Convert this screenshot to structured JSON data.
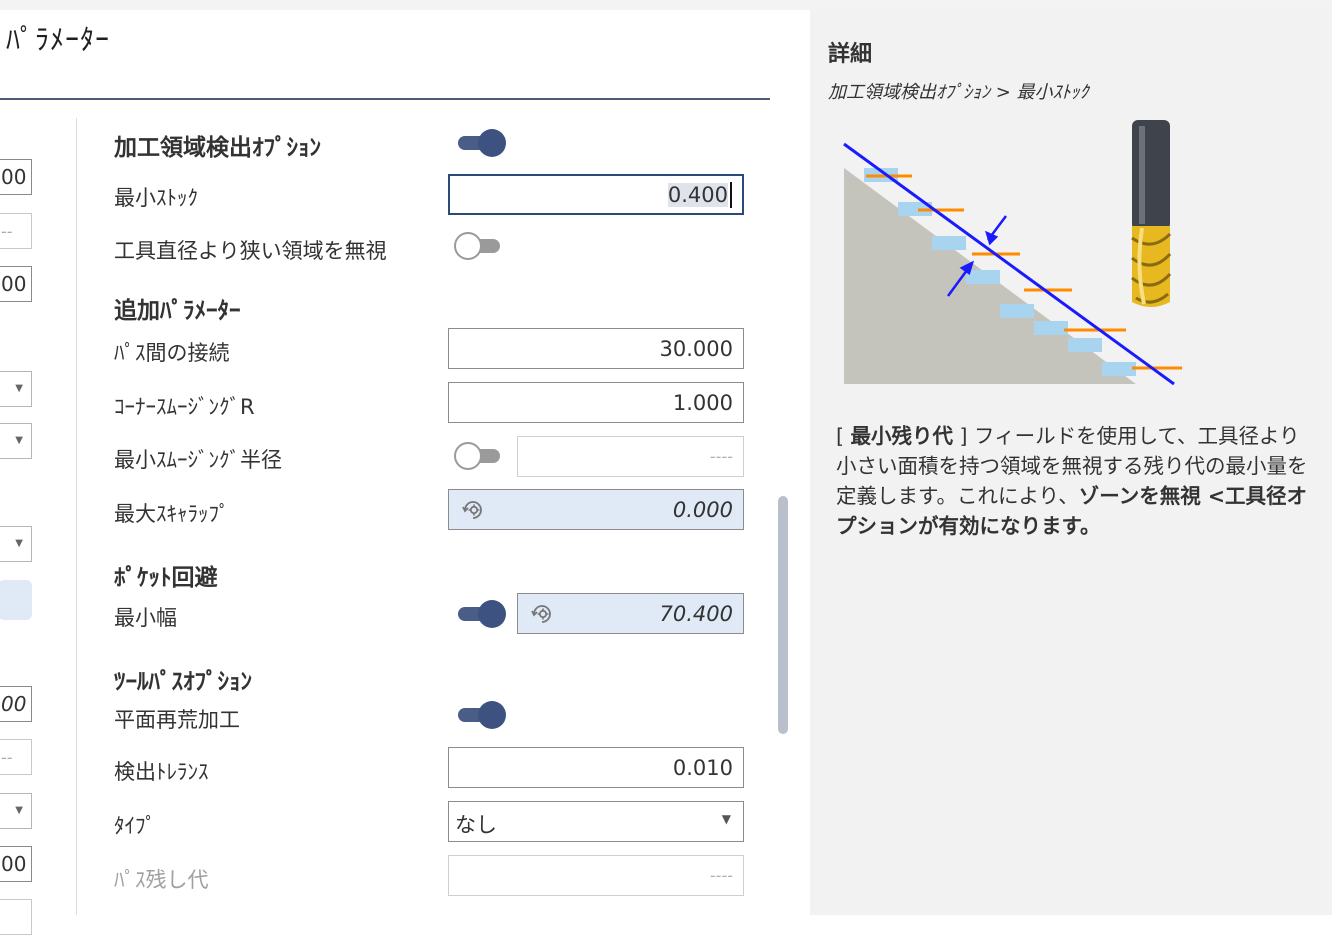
{
  "header": {
    "title": "ﾊﾟﾗﾒｰﾀｰ"
  },
  "left_column": {
    "items": [
      {
        "text": "00",
        "style": "input"
      },
      {
        "text": "--",
        "style": "dash"
      },
      {
        "text": "00",
        "style": "input"
      },
      {
        "text": "",
        "style": "select"
      },
      {
        "text": "",
        "style": "select"
      },
      {
        "text": "",
        "style": "select"
      },
      {
        "text": "",
        "style": "highlight"
      },
      {
        "text": "00",
        "style": "italic"
      },
      {
        "text": "--",
        "style": "dash"
      },
      {
        "text": "",
        "style": "select"
      },
      {
        "text": "00",
        "style": "input"
      },
      {
        "text": "",
        "style": "dash"
      }
    ]
  },
  "sections": {
    "detection": {
      "title": "加工領域検出ｵﾌﾟｼｮﾝ",
      "enabled": true,
      "min_stock_label": "最小ｽﾄｯｸ",
      "min_stock_value": "0.400",
      "ignore_narrow_label": "工具直径より狭い領域を無視",
      "ignore_narrow_enabled": false
    },
    "additional": {
      "title": "追加ﾊﾟﾗﾒｰﾀｰ",
      "pass_link_label": "ﾊﾟｽ間の接続",
      "pass_link_value": "30.000",
      "corner_radius_label": "ｺｰﾅｰｽﾑｰｼﾞﾝｸﾞR",
      "corner_radius_value": "1.000",
      "min_smoothing_label": "最小ｽﾑｰｼﾞﾝｸﾞ半径",
      "min_smoothing_enabled": false,
      "min_smoothing_value": "----",
      "max_scallop_label": "最大ｽｷｬﾗｯﾌﾟ",
      "max_scallop_value": "0.000"
    },
    "pocket": {
      "title": "ﾎﾟｹｯﾄ回避",
      "min_width_label": "最小幅",
      "min_width_enabled": true,
      "min_width_value": "70.400"
    },
    "toolpath": {
      "title": "ﾂｰﾙﾊﾟｽｵﾌﾟｼｮﾝ",
      "flat_rerough_label": "平面再荒加工",
      "flat_rerough_enabled": true,
      "tolerance_label": "検出ﾄﾚﾗﾝｽ",
      "tolerance_value": "0.010",
      "type_label": "ﾀｲﾌﾟ",
      "type_value": "なし",
      "pass_stock_label": "ﾊﾟｽ残し代",
      "pass_stock_value": "----"
    }
  },
  "details": {
    "title": "詳細",
    "breadcrumb": "加工領域検出ｵﾌﾟｼｮﾝ > 最小ｽﾄｯｸ",
    "desc_bracket_open": "[ ",
    "desc_term": "最小残り代",
    "desc_bracket_close": " ]",
    "desc_text": " フィールドを使用して、工具径より小さい面積を持つ領域を無視する残り代の最小量を定義します。これにより、",
    "desc_bold": "ゾーンを無視 <工具径オプションが有効になります。"
  },
  "colors": {
    "accent": "#3e5282",
    "calc_bg": "#dfeaf6",
    "panel_bg": "#f2f2f2",
    "diagram_line": "#1a1aff",
    "diagram_stock": "#ff8c00",
    "diagram_steps": "#a8d4f0",
    "tool_gold": "#e8b820"
  },
  "icons": {
    "calc": "calculator-refresh-icon",
    "dropdown": "chevron-down-icon"
  }
}
